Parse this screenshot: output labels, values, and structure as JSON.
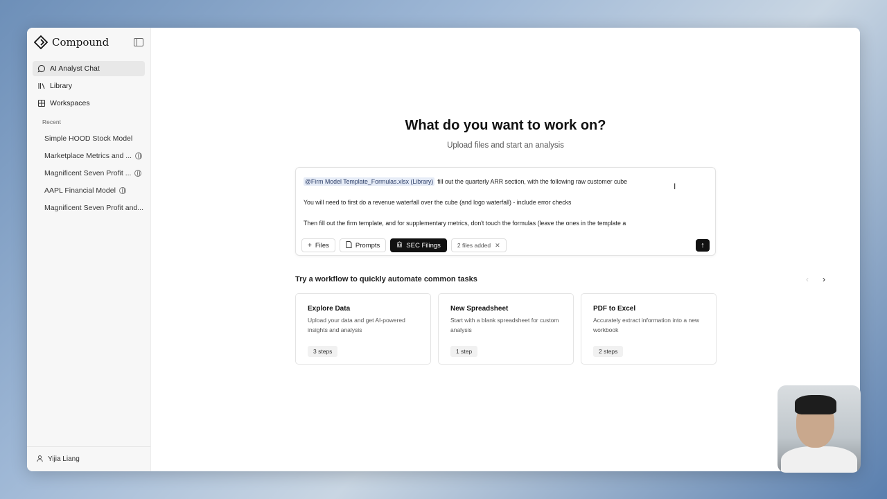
{
  "app": {
    "name": "Compound"
  },
  "nav": [
    {
      "label": "AI Analyst Chat",
      "icon": "chat-bubble-icon",
      "active": true
    },
    {
      "label": "Library",
      "icon": "library-icon",
      "active": false
    },
    {
      "label": "Workspaces",
      "icon": "grid-icon",
      "active": false
    }
  ],
  "recent": {
    "label": "Recent",
    "items": [
      {
        "label": "Simple HOOD Stock Model",
        "shared": false
      },
      {
        "label": "Marketplace Metrics and ...",
        "shared": true
      },
      {
        "label": "Magnificent Seven Profit ...",
        "shared": true
      },
      {
        "label": "AAPL Financial Model",
        "shared": true
      },
      {
        "label": "Magnificent Seven Profit and...",
        "shared": false
      }
    ]
  },
  "user": {
    "name": "Yijia Liang"
  },
  "hero": {
    "title": "What do you want to work on?",
    "subtitle": "Upload files and start an analysis"
  },
  "composer": {
    "mention": "@Firm Model Template_Formulas.xlsx (Library)",
    "line1": "fill out the quarterly ARR section, with the following raw customer cube",
    "line2": "You will need to first do a revenue waterfall over the cube (and logo waterfall) - include error checks",
    "line3": "Then fill out the firm template, and for supplementary metrics, don't touch the formulas (leave the ones in the template a",
    "files_label": "Files",
    "prompts_label": "Prompts",
    "sec_label": "SEC Filings",
    "files_added": "2 files added"
  },
  "workflows": {
    "heading": "Try a workflow to quickly automate common tasks",
    "cards": [
      {
        "title": "Explore Data",
        "desc": "Upload your data and get AI-powered insights and analysis",
        "steps": "3 steps"
      },
      {
        "title": "New Spreadsheet",
        "desc": "Start with a blank spreadsheet for custom analysis",
        "steps": "1 step"
      },
      {
        "title": "PDF to Excel",
        "desc": "Accurately extract information into a new workbook",
        "steps": "2 steps"
      }
    ]
  }
}
